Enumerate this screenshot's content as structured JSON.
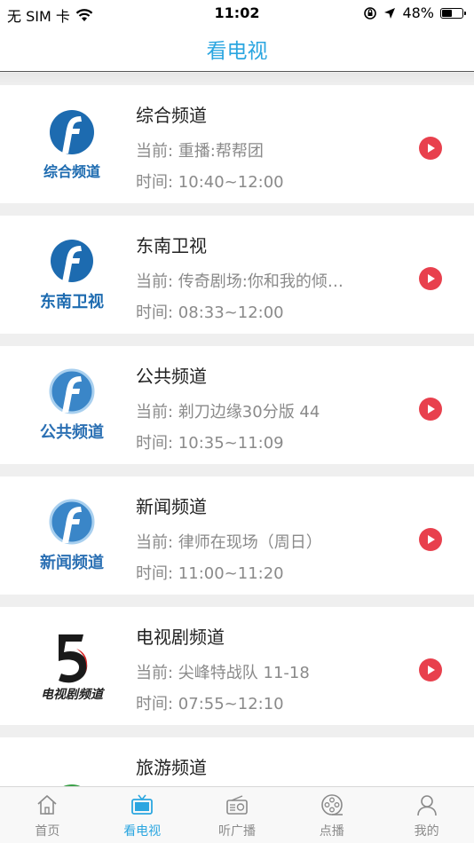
{
  "status_bar": {
    "carrier": "无 SIM 卡",
    "time": "11:02",
    "battery": "48%"
  },
  "nav": {
    "title": "看电视"
  },
  "channels": [
    {
      "name": "综合频道",
      "current": "当前: 重播:帮帮团",
      "time": "时间: 10:40~12:00",
      "logo_text": "综合频道"
    },
    {
      "name": "东南卫视",
      "current": "当前: 传奇剧场:你和我的倾…",
      "time": "时间: 08:33~12:00",
      "logo_text": "东南卫视"
    },
    {
      "name": "公共频道",
      "current": "当前: 剃刀边缘30分版 44",
      "time": "时间: 10:35~11:09",
      "logo_text": "公共频道"
    },
    {
      "name": "新闻频道",
      "current": "当前: 律师在现场（周日）",
      "time": "时间: 11:00~11:20",
      "logo_text": "新闻频道"
    },
    {
      "name": "电视剧频道",
      "current": "当前: 尖峰特战队 11-18",
      "time": "时间: 07:55~12:10",
      "logo_text": "电视剧频道"
    },
    {
      "name": "旅游频道",
      "current": "",
      "time": "",
      "logo_text": ""
    }
  ],
  "tabs": [
    {
      "label": "首页",
      "icon": "home-icon"
    },
    {
      "label": "看电视",
      "icon": "tv-icon"
    },
    {
      "label": "听广播",
      "icon": "radio-icon"
    },
    {
      "label": "点播",
      "icon": "film-reel-icon"
    },
    {
      "label": "我的",
      "icon": "user-icon"
    }
  ],
  "colors": {
    "accent": "#2ba6e0",
    "play": "#e8404d",
    "logo_blue": "#1d6bb0"
  }
}
